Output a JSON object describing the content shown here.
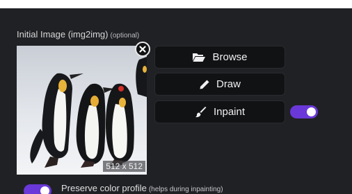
{
  "init_image": {
    "title": "Initial Image (img2img)",
    "optional_label": "(optional)",
    "image_size_label": "512 x 512"
  },
  "buttons": {
    "browse_label": "Browse",
    "draw_label": "Draw",
    "inpaint_label": "Inpaint"
  },
  "inpaint_toggle": {
    "checked": true
  },
  "preserve": {
    "label": "Preserve color profile",
    "hint": "(helps during inpainting)",
    "checked": true
  },
  "icons": {
    "browse": "folder-open-icon",
    "draw": "pencil-icon",
    "inpaint": "paintbrush-icon",
    "remove": "close-icon"
  },
  "colors": {
    "panel_bg": "#202124",
    "button_bg": "#111214",
    "toggle_on": "#6a38d8"
  }
}
